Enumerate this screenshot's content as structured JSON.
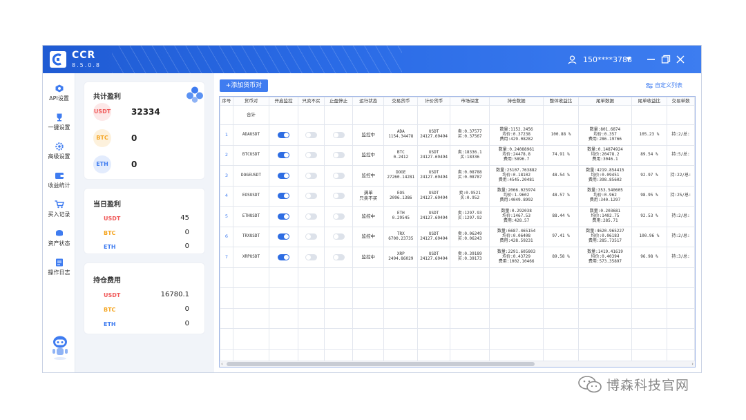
{
  "app": {
    "name": "CCR",
    "version": "8.5.0.8"
  },
  "user": {
    "name": "150****3788"
  },
  "colors": {
    "accent": "#3f7cf0",
    "titlebar": "#2a6be6",
    "usdt": "#f05a5a",
    "btc": "#f5a623",
    "eth": "#3f7cf0"
  },
  "nav": [
    {
      "label": "API设置",
      "icon": "api-icon"
    },
    {
      "label": "一键设置",
      "icon": "trophy-icon"
    },
    {
      "label": "高级设置",
      "icon": "settings-icon"
    },
    {
      "label": "收益统计",
      "icon": "wallet-icon"
    },
    {
      "label": "买入记录",
      "icon": "cart-icon"
    },
    {
      "label": "资产状态",
      "icon": "asset-icon"
    },
    {
      "label": "操作日志",
      "icon": "log-icon"
    }
  ],
  "summary": {
    "total": {
      "title": "共计盈利",
      "usdt_label": "USDT",
      "usdt": "32334",
      "btc_label": "BTC",
      "btc": "0",
      "eth_label": "ETH",
      "eth": "0"
    },
    "daily": {
      "title": "当日盈利",
      "usdt_label": "USDT",
      "usdt": "45",
      "btc_label": "BTC",
      "btc": "0",
      "eth_label": "ETH",
      "eth": "0"
    },
    "fees": {
      "title": "持仓费用",
      "usdt_label": "USDT",
      "usdt": "16780.1",
      "btc_label": "BTC",
      "btc": "0",
      "eth_label": "ETH",
      "eth": "0"
    }
  },
  "toolbar": {
    "add_label": "+添加货币对",
    "custom_label": "自定义列表"
  },
  "table": {
    "headers": [
      "序号",
      "货币对",
      "开启监控",
      "只卖不买",
      "止盈停止",
      "运行状态",
      "交易货币",
      "计价货币",
      "市场深度",
      "持仓数据",
      "整体收益比",
      "尾单数据",
      "尾单收益比",
      "交易单数"
    ],
    "summary_label": "合计",
    "rows": [
      {
        "idx": "1",
        "pair": "ADAUSDT",
        "monitor": true,
        "sell_only": false,
        "tp_stop": false,
        "status": [
          "监控中"
        ],
        "trade": [
          "ADA",
          "1154.34478"
        ],
        "quote": [
          "USDT",
          "24127.69494"
        ],
        "depth": [
          "卖:0.37577",
          "买:0.37567"
        ],
        "pos": [
          "数量:1152.2456",
          "均价:0.37238",
          "费用:429.08282"
        ],
        "ratio": "100.88 %",
        "tail": [
          "数量:801.6874",
          "均价:0.357",
          "费用:286.19766"
        ],
        "tail_ratio": "105.23 %",
        "orders": "持:2/总:"
      },
      {
        "idx": "2",
        "pair": "BTCUSDT",
        "monitor": true,
        "sell_only": false,
        "tp_stop": false,
        "status": [
          "监控中"
        ],
        "trade": [
          "BTC",
          "0.2412"
        ],
        "quote": [
          "USDT",
          "24127.69494"
        ],
        "depth": [
          "卖:18336.1",
          "买:18336"
        ],
        "pos": [
          "数量:0.24088961",
          "均价:24478.8",
          "费用:5896.7"
        ],
        "ratio": "74.91 %",
        "tail": [
          "数量:0.14874924",
          "均价:20478.2",
          "费用:3046.1"
        ],
        "tail_ratio": "89.54 %",
        "orders": "持:5/总:"
      },
      {
        "idx": "3",
        "pair": "DOGEUSDT",
        "monitor": true,
        "sell_only": false,
        "tp_stop": false,
        "status": [
          "监控中"
        ],
        "trade": [
          "DOGE",
          "27260.14281"
        ],
        "quote": [
          "USDT",
          "24127.69494"
        ],
        "depth": [
          "卖:0.08788",
          "买:0.08787"
        ],
        "pos": [
          "数量:25107.763882",
          "均价:0.18102",
          "费用:4545.20481"
        ],
        "ratio": "48.54 %",
        "tail": [
          "数量:4219.854415",
          "均价:0.09451",
          "费用:398.85602"
        ],
        "tail_ratio": "92.97 %",
        "orders": "持:22/总:"
      },
      {
        "idx": "4",
        "pair": "EOSUSDT",
        "monitor": true,
        "sell_only": false,
        "tp_stop": false,
        "status": [
          "满单",
          "只卖不买"
        ],
        "trade": [
          "EOS",
          "2096.1386"
        ],
        "quote": [
          "USDT",
          "24127.69494"
        ],
        "depth": [
          "卖:0.9521",
          "买:0.952"
        ],
        "pos": [
          "数量:2066.025974",
          "均价:1.9602",
          "费用:4049.8992"
        ],
        "ratio": "48.57 %",
        "tail": [
          "数量:353.540605",
          "均价:0.962",
          "费用:340.1297"
        ],
        "tail_ratio": "98.95 %",
        "orders": "持:25/总:"
      },
      {
        "idx": "5",
        "pair": "ETHUSDT",
        "monitor": true,
        "sell_only": false,
        "tp_stop": false,
        "status": [
          "监控中"
        ],
        "trade": [
          "ETH",
          "0.29545"
        ],
        "quote": [
          "USDT",
          "24127.69494"
        ],
        "depth": [
          "卖:1297.93",
          "买:1297.92"
        ],
        "pos": [
          "数量:0.292038",
          "均价:1467.53",
          "费用:428.57"
        ],
        "ratio": "88.44 %",
        "tail": [
          "数量:0.203681",
          "均价:1402.75",
          "费用:285.71"
        ],
        "tail_ratio": "92.53 %",
        "orders": "持:2/总:"
      },
      {
        "idx": "6",
        "pair": "TRXUSDT",
        "monitor": true,
        "sell_only": false,
        "tp_stop": false,
        "status": [
          "监控中"
        ],
        "trade": [
          "TRX",
          "6700.23735"
        ],
        "quote": [
          "USDT",
          "24127.69494"
        ],
        "depth": [
          "卖:0.06249",
          "买:0.06243"
        ],
        "pos": [
          "数量:6687.465154",
          "均价:0.06408",
          "费用:428.59231"
        ],
        "ratio": "97.41 %",
        "tail": [
          "数量:4620.965227",
          "均价:0.06183",
          "费用:285.73517"
        ],
        "tail_ratio": "100.96 %",
        "orders": "持:2/总:"
      },
      {
        "idx": "7",
        "pair": "XRPUSDT",
        "monitor": true,
        "sell_only": false,
        "tp_stop": false,
        "status": [
          "监控中"
        ],
        "trade": [
          "XRP",
          "2494.86029"
        ],
        "quote": [
          "USDT",
          "24127.69494"
        ],
        "depth": [
          "卖:0.39189",
          "买:0.39173"
        ],
        "pos": [
          "数量:2291.605803",
          "均价:0.43729",
          "费用:1002.10466"
        ],
        "ratio": "89.58 %",
        "tail": [
          "数量:1419.41619",
          "均价:0.40394",
          "费用:573.35897"
        ],
        "tail_ratio": "96.98 %",
        "orders": "持:3/总:"
      }
    ],
    "empty_rows": 5
  },
  "watermark": {
    "text": "博森科技官网"
  }
}
